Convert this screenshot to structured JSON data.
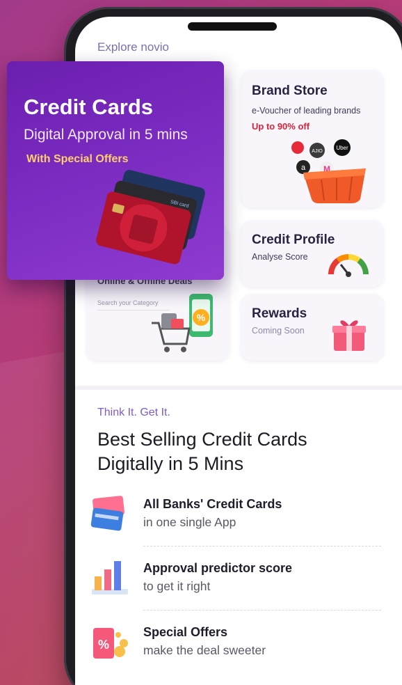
{
  "explore": {
    "label": "Explore novio"
  },
  "promo": {
    "title": "Credit Cards",
    "subtitle": "Digital Approval in 5 mins",
    "offer": "With Special Offers",
    "card_logo": "SBI card"
  },
  "cards": {
    "brand_store": {
      "title": "Brand Store",
      "sub": "e-Voucher of leading brands",
      "offer": "Up to 90% off"
    },
    "credit_profile": {
      "title": "Credit Profile",
      "sub": "Analyse Score"
    },
    "rewards": {
      "title": "Rewards",
      "sub": "Coming Soon"
    },
    "deals": {
      "title": "Online & Offline Deals",
      "search_placeholder": "Search your Category"
    }
  },
  "brand_logos": [
    "AJIO",
    "Uber",
    "M",
    "a"
  ],
  "section": {
    "eyebrow": "Think It. Get It.",
    "heading_line1": "Best Selling Credit Cards",
    "heading_line2": "Digitally in 5 Mins"
  },
  "features": [
    {
      "title": "All Banks' Credit Cards",
      "sub": "in one single App",
      "icon": "credit-cards-icon"
    },
    {
      "title": "Approval predictor score",
      "sub": "to get it right",
      "icon": "bar-chart-icon"
    },
    {
      "title": "Special Offers",
      "sub": "make the deal sweeter",
      "icon": "offer-tag-icon"
    }
  ],
  "colors": {
    "accent_purple": "#7a2bc0",
    "offer_red": "#d8243b",
    "offer_gold": "#ffcf6b",
    "background_magenta": "#b53b78"
  }
}
